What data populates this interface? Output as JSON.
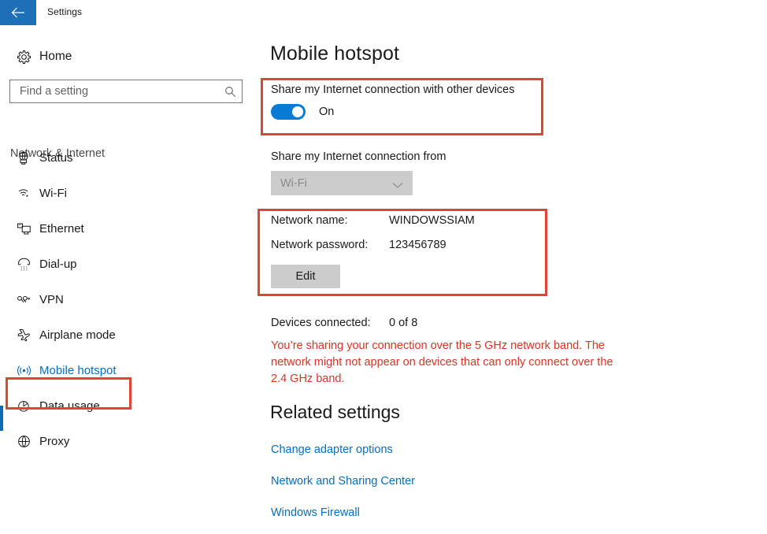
{
  "titlebar": {
    "back_icon": "back-arrow-icon",
    "title": "Settings",
    "accent_color": "#1d70b8"
  },
  "sidebar": {
    "home": {
      "label": "Home",
      "icon": "gear-icon"
    },
    "search": {
      "placeholder": "Find a setting",
      "value": "",
      "icon": "search-icon"
    },
    "category": "Network & Internet",
    "items": [
      {
        "label": "Status",
        "icon": "globe-monitor-icon",
        "selected": false
      },
      {
        "label": "Wi-Fi",
        "icon": "wifi-icon",
        "selected": false
      },
      {
        "label": "Ethernet",
        "icon": "ethernet-icon",
        "selected": false
      },
      {
        "label": "Dial-up",
        "icon": "dialup-phone-icon",
        "selected": false
      },
      {
        "label": "VPN",
        "icon": "vpn-key-icon",
        "selected": false
      },
      {
        "label": "Airplane mode",
        "icon": "airplane-icon",
        "selected": false
      },
      {
        "label": "Mobile hotspot",
        "icon": "hotspot-broadcast-icon",
        "selected": true
      },
      {
        "label": "Data usage",
        "icon": "pie-chart-icon",
        "selected": false
      },
      {
        "label": "Proxy",
        "icon": "globe-icon",
        "selected": false
      }
    ],
    "selected_color": "#0a6cbe"
  },
  "main": {
    "page_title": "Mobile hotspot",
    "share_toggle": {
      "label": "Share my Internet connection with other devices",
      "state": "On",
      "on_color": "#0a7bd4"
    },
    "share_from": {
      "label": "Share my Internet connection from",
      "value": "Wi-Fi",
      "chevron_icon": "chevron-down-icon",
      "disabled": true
    },
    "network_info": {
      "name_key": "Network name:",
      "name_value": "WINDOWSSIAM",
      "password_key": "Network password:",
      "password_value": "123456789",
      "edit_label": "Edit"
    },
    "devices": {
      "key": "Devices connected:",
      "value": "0 of 8"
    },
    "band_warning": {
      "text": "You’re sharing your connection over the 5 GHz network band. The network might not appear on devices that can only connect over the 2.4 GHz band.",
      "color": "#d9342b"
    },
    "related": {
      "title": "Related settings",
      "links": [
        "Change adapter options",
        "Network and Sharing Center",
        "Windows Firewall"
      ],
      "link_color": "#0a6cbe"
    }
  },
  "annotations": {
    "color": "#e04337",
    "boxes": [
      "share-toggle-highlight",
      "network-info-highlight",
      "sidebar-mobile-hotspot-highlight"
    ]
  }
}
